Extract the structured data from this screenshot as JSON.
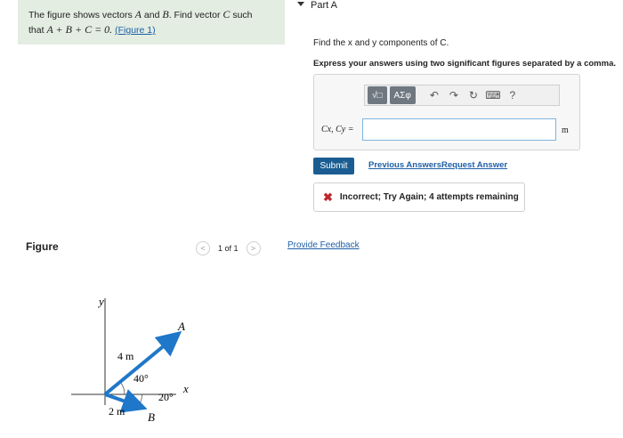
{
  "problem": {
    "text_1": "The figure shows vectors",
    "vec_a": "A",
    "text_and": "and",
    "vec_b": "B",
    "text_2": ". Find vector",
    "vec_c": "C",
    "text_such": "such",
    "text_that": "that",
    "equation": "A + B + C = 0.",
    "figure_link": "(Figure 1)"
  },
  "part": {
    "label": "Part A"
  },
  "question": {
    "find": "Find the x and y components of C.",
    "instructions": "Express your answers using two significant figures separated by a comma."
  },
  "toolbar": {
    "buttons": [
      "√□",
      "ΑΣφ",
      "undo-icon",
      "redo-icon",
      "reset-icon",
      "keyboard-icon",
      "help-icon"
    ],
    "help_label": "?"
  },
  "answer": {
    "label": "Cx, Cy =",
    "value": "",
    "unit": "m"
  },
  "actions": {
    "submit": "Submit",
    "previous_answers": "Previous Answers",
    "request_answer": "Request Answer"
  },
  "feedback": {
    "message": "Incorrect; Try Again; 4 attempts remaining"
  },
  "figure": {
    "title": "Figure",
    "pager": "1 of 1",
    "provide_feedback": "Provide Feedback",
    "axis_y": "y",
    "axis_x": "x",
    "label_a": "A",
    "label_b": "B",
    "mag_a": "4 m",
    "mag_b": "2 m",
    "angle_a": "40°",
    "angle_b": "20°",
    "arrow_color": "#1f77c9"
  },
  "colors": {
    "problem_bg": "#e3ede1",
    "submit_bg": "#1b5d92",
    "link": "#1f5fa8",
    "error": "#c0262d"
  }
}
